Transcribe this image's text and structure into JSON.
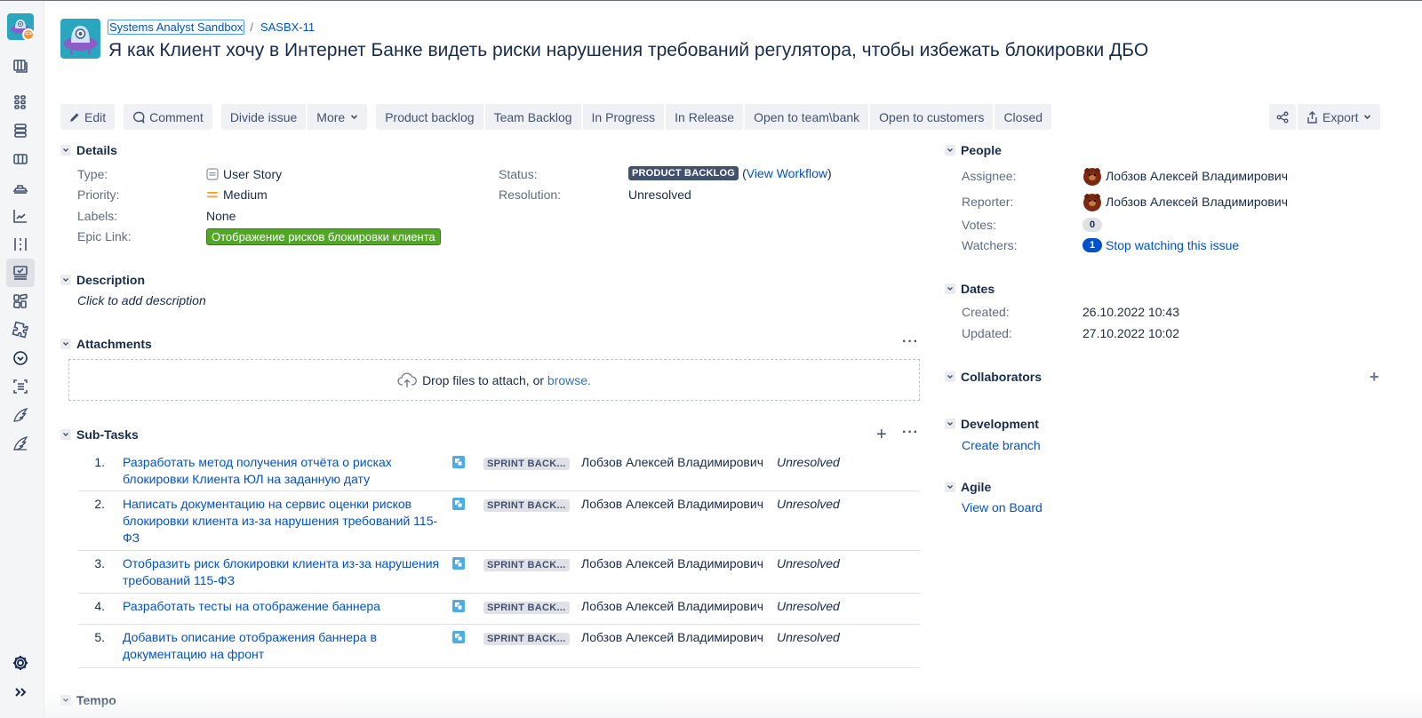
{
  "sidebar": {
    "items": [
      {
        "icon": "backlog-icon"
      },
      {
        "icon": "board-icon"
      },
      {
        "icon": "releases-icon"
      },
      {
        "icon": "components-icon"
      },
      {
        "icon": "ship-icon"
      },
      {
        "icon": "reports-icon"
      },
      {
        "icon": "sprints-icon"
      },
      {
        "icon": "issues-icon",
        "active": true
      },
      {
        "icon": "pages-icon"
      },
      {
        "icon": "add-ons-icon"
      },
      {
        "icon": "tempo-icon"
      },
      {
        "icon": "checklist-icon"
      },
      {
        "icon": "wing-icon"
      },
      {
        "icon": "wing-2-icon"
      }
    ],
    "settings_icon": "gear-icon",
    "expand_icon": "expand-icon"
  },
  "breadcrumb": {
    "project": "Systems Analyst Sandbox",
    "separator": "/",
    "issue_key": "SASBX-11"
  },
  "issue": {
    "title": "Я как Клиент хочу в Интернет Банке видеть риски нарушения требований регулятора, чтобы избежать блокировки ДБО"
  },
  "toolbar": {
    "edit": "Edit",
    "comment": "Comment",
    "divide_issue": "Divide issue",
    "more": "More",
    "transitions": [
      "Product backlog",
      "Team Backlog",
      "In Progress",
      "In Release",
      "Open to team\\bank",
      "Open to customers",
      "Closed"
    ],
    "export": "Export"
  },
  "details": {
    "heading": "Details",
    "type_label": "Type:",
    "type_value": "User Story",
    "priority_label": "Priority:",
    "priority_value": "Medium",
    "labels_label": "Labels:",
    "labels_value": "None",
    "epic_label": "Epic Link:",
    "epic_value": "Отображение рисков блокировки клиента",
    "status_label": "Status:",
    "status_value": "PRODUCT BACKLOG",
    "view_workflow": "View Workflow",
    "resolution_label": "Resolution:",
    "resolution_value": "Unresolved"
  },
  "description": {
    "heading": "Description",
    "placeholder": "Click to add description"
  },
  "attachments": {
    "heading": "Attachments",
    "drop_text": "Drop files to attach, or",
    "browse": "browse."
  },
  "subtasks": {
    "heading": "Sub-Tasks",
    "items": [
      {
        "num": "1.",
        "title": "Разработать метод получения отчёта о рисках блокировки Клиента ЮЛ на заданную дату",
        "status": "SPRINT BACK...",
        "assignee": "Лобзов Алексей Владимирович",
        "resolution": "Unresolved"
      },
      {
        "num": "2.",
        "title": "Написать документацию на сервис оценки рисков блокировки клиента из-за нарушения требований 115-ФЗ",
        "status": "SPRINT BACK...",
        "assignee": "Лобзов Алексей Владимирович",
        "resolution": "Unresolved"
      },
      {
        "num": "3.",
        "title": "Отобразить риск блокировки клиента из-за нарушения требований 115-ФЗ",
        "status": "SPRINT BACK...",
        "assignee": "Лобзов Алексей Владимирович",
        "resolution": "Unresolved"
      },
      {
        "num": "4.",
        "title": "Разработать тесты на отображение баннера",
        "status": "SPRINT BACK...",
        "assignee": "Лобзов Алексей Владимирович",
        "resolution": "Unresolved"
      },
      {
        "num": "5.",
        "title": "Добавить описание отображения баннера в документацию на фронт",
        "status": "SPRINT BACK...",
        "assignee": "Лобзов Алексей Владимирович",
        "resolution": "Unresolved"
      }
    ]
  },
  "tempo": {
    "heading": "Tempo"
  },
  "people": {
    "heading": "People",
    "assignee_label": "Assignee:",
    "assignee": "Лобзов Алексей Владимирович",
    "reporter_label": "Reporter:",
    "reporter": "Лобзов Алексей Владимирович",
    "votes_label": "Votes:",
    "votes": "0",
    "watchers_label": "Watchers:",
    "watchers": "1",
    "stop_watching": "Stop watching this issue"
  },
  "dates": {
    "heading": "Dates",
    "created_label": "Created:",
    "created": "26.10.2022 10:43",
    "updated_label": "Updated:",
    "updated": "27.10.2022 10:02"
  },
  "collaborators": {
    "heading": "Collaborators"
  },
  "development": {
    "heading": "Development",
    "create_branch": "Create branch"
  },
  "agile": {
    "heading": "Agile",
    "view_on_board": "View on Board"
  },
  "colors": {
    "link": "#0052cc",
    "status_lozenge": "#42526e",
    "epic": "#51a825",
    "priority_medium": "#ff991f"
  }
}
